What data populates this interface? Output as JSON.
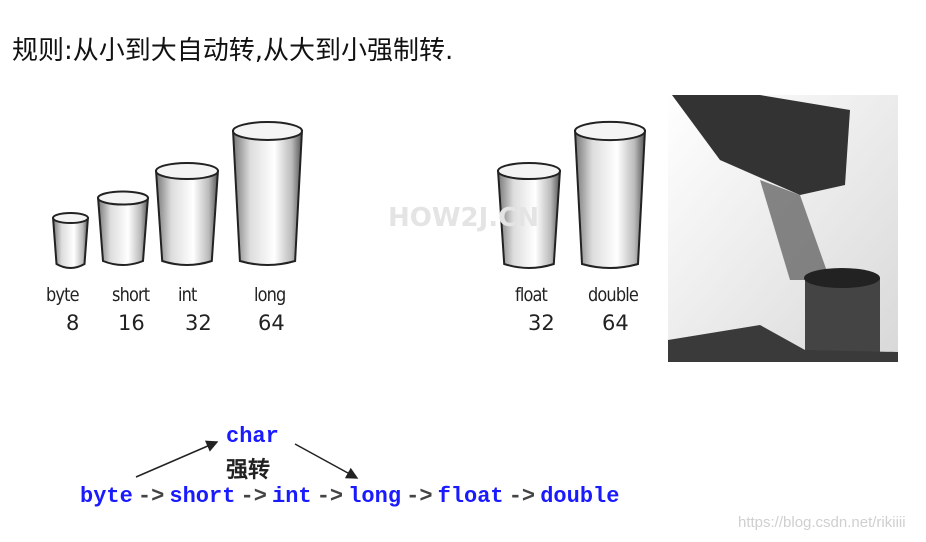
{
  "title": "规则:从小到大自动转,从大到小强制转.",
  "watermark": "HOW2J.CN",
  "integer_cups": [
    {
      "name": "byte",
      "bits": "8"
    },
    {
      "name": "short",
      "bits": "16"
    },
    {
      "name": "int",
      "bits": "32"
    },
    {
      "name": "long",
      "bits": "64"
    }
  ],
  "float_cups": [
    {
      "name": "float",
      "bits": "32"
    },
    {
      "name": "double",
      "bits": "64"
    }
  ],
  "chain": {
    "types": [
      "byte",
      "short",
      "int",
      "long",
      "float",
      "double"
    ],
    "arrow": "->",
    "char": "char",
    "cast_label": "强转"
  },
  "credit": "https://blog.csdn.net/rikiiii",
  "colors": {
    "code": "#1a1aff"
  }
}
